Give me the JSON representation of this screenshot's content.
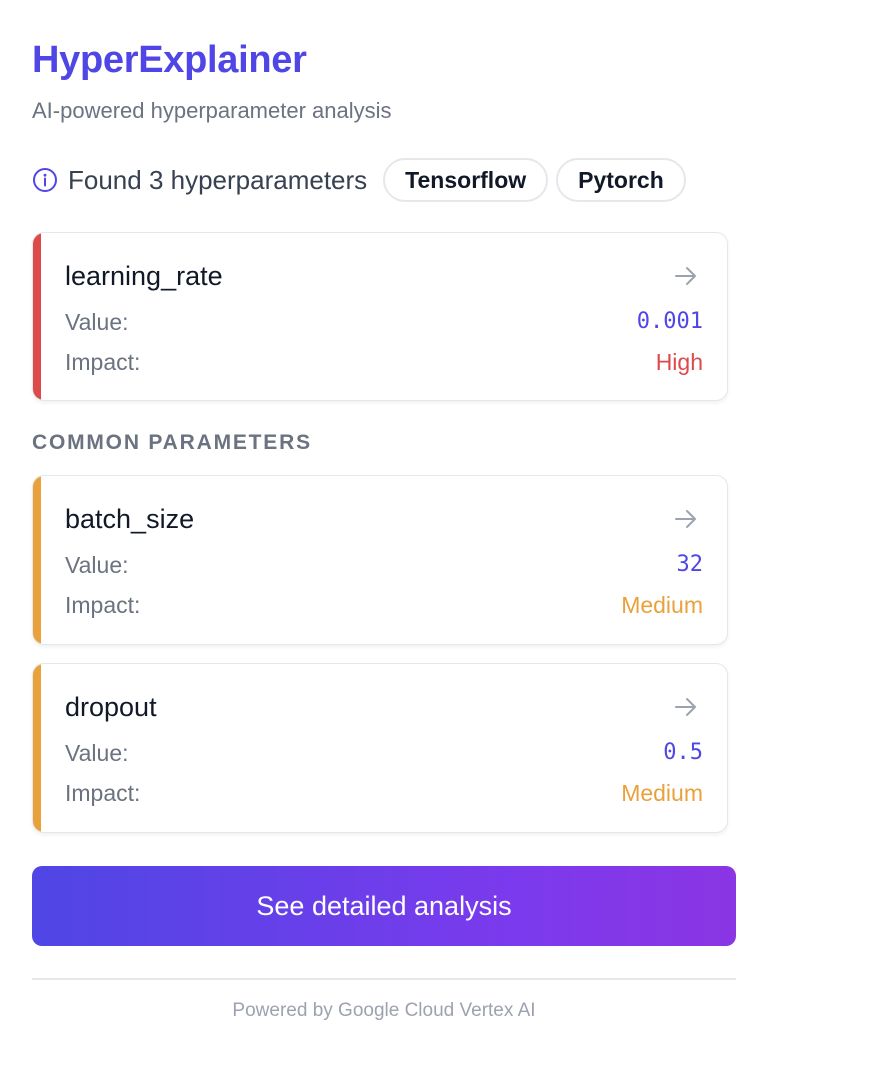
{
  "header": {
    "title": "HyperExplainer",
    "subtitle": "AI-powered hyperparameter analysis"
  },
  "summary": {
    "found_text": "Found 3 hyperparameters",
    "frameworks": [
      "Tensorflow",
      "Pytorch"
    ]
  },
  "labels": {
    "value": "Value:",
    "impact": "Impact:"
  },
  "section": {
    "common_label": "COMMON PARAMETERS"
  },
  "parameters": [
    {
      "name": "learning_rate",
      "value": "0.001",
      "impact": "High",
      "impact_color": "#dc4a4a"
    },
    {
      "name": "batch_size",
      "value": "32",
      "impact": "Medium",
      "impact_color": "#e9a23b"
    },
    {
      "name": "dropout",
      "value": "0.5",
      "impact": "Medium",
      "impact_color": "#e9a23b"
    }
  ],
  "actions": {
    "detail_button": "See detailed analysis"
  },
  "footer": {
    "text": "Powered by Google Cloud Vertex AI"
  },
  "colors": {
    "brand": "#4f46e5",
    "high": "#dc4a4a",
    "medium": "#e9a23b",
    "cta_gradient_start": "#4f46e5",
    "cta_gradient_end": "#8b35e3"
  },
  "icons": {
    "info": "info-circle-icon",
    "arrow": "arrow-right-icon"
  }
}
